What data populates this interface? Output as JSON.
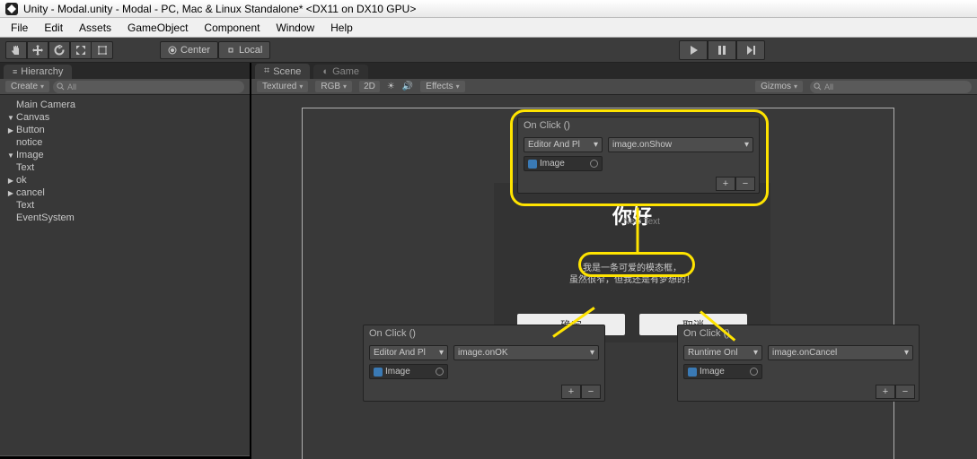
{
  "window": {
    "title": "Unity - Modal.unity - Modal - PC, Mac & Linux Standalone* <DX11 on DX10 GPU>"
  },
  "menubar": [
    "File",
    "Edit",
    "Assets",
    "GameObject",
    "Component",
    "Window",
    "Help"
  ],
  "toolbar": {
    "center": "Center",
    "local": "Local"
  },
  "hierarchy": {
    "tab": "Hierarchy",
    "create": "Create",
    "search_placeholder": "All",
    "items": [
      {
        "label": "Main Camera",
        "indent": 0,
        "arrow": ""
      },
      {
        "label": "Canvas",
        "indent": 0,
        "arrow": "▼"
      },
      {
        "label": "Button",
        "indent": 1,
        "arrow": "▶"
      },
      {
        "label": "notice",
        "indent": 1,
        "arrow": ""
      },
      {
        "label": "Image",
        "indent": 1,
        "arrow": "▼"
      },
      {
        "label": "Text",
        "indent": 2,
        "arrow": ""
      },
      {
        "label": "ok",
        "indent": 2,
        "arrow": "▶"
      },
      {
        "label": "cancel",
        "indent": 2,
        "arrow": "▶"
      },
      {
        "label": "Text",
        "indent": 2,
        "arrow": ""
      },
      {
        "label": "EventSystem",
        "indent": 0,
        "arrow": ""
      }
    ]
  },
  "scene": {
    "tabs": {
      "scene": "Scene",
      "game": "Game"
    },
    "bar": {
      "shading": "Textured",
      "color": "RGB",
      "mode": "2D",
      "effects": "Effects",
      "gizmos": "Gizmos",
      "search": "All"
    },
    "modal": {
      "title": "你好",
      "subtitle": "New Text",
      "body1": "我是一条可爱的模态框，",
      "body2": "虽然很窄，但我还是有梦想的！",
      "ok": "确定",
      "cancel": "取消"
    },
    "onclick_top": {
      "header": "On Click ()",
      "mode": "Editor And Pl",
      "func": "image.onShow",
      "obj": "Image"
    },
    "onclick_left": {
      "header": "On Click ()",
      "mode": "Editor And Pl",
      "func": "image.onOK",
      "obj": "Image"
    },
    "onclick_right": {
      "header": "On Click ()",
      "mode": "Runtime Onl",
      "func": "image.onCancel",
      "obj": "Image"
    }
  }
}
